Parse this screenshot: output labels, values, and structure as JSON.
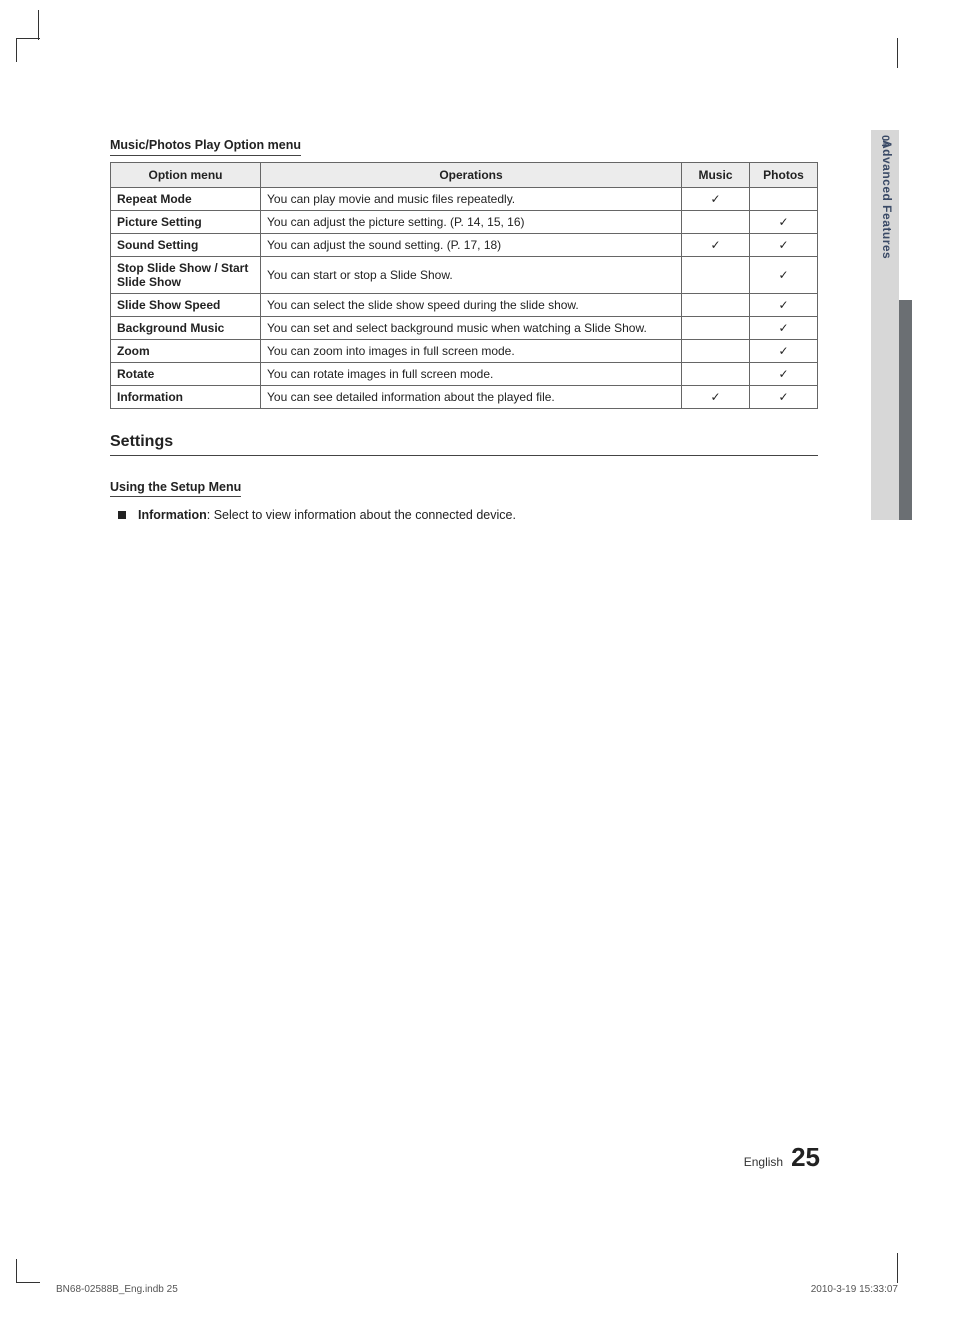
{
  "side_tab": {
    "number": "04",
    "label": "Advanced Features"
  },
  "section_title": "Music/Photos Play Option menu",
  "table": {
    "headers": {
      "option": "Option menu",
      "operations": "Operations",
      "music": "Music",
      "photos": "Photos"
    },
    "check": "✓",
    "rows": [
      {
        "name": "Repeat Mode",
        "op": "You can play movie and music files repeatedly.",
        "music": true,
        "photos": false
      },
      {
        "name": "Picture Setting",
        "op": "You can adjust the picture setting. (P. 14, 15, 16)",
        "music": false,
        "photos": true
      },
      {
        "name": "Sound Setting",
        "op": "You can adjust the sound setting. (P. 17, 18)",
        "music": true,
        "photos": true
      },
      {
        "name": "Stop Slide Show / Start Slide Show",
        "op": "You can start or stop a Slide Show.",
        "music": false,
        "photos": true
      },
      {
        "name": "Slide Show Speed",
        "op": "You can select the slide show speed during the slide show.",
        "music": false,
        "photos": true
      },
      {
        "name": "Background Music",
        "op": "You can set and select background music when watching a Slide Show.",
        "music": false,
        "photos": true
      },
      {
        "name": "Zoom",
        "op": "You can zoom into images in full screen mode.",
        "music": false,
        "photos": true
      },
      {
        "name": "Rotate",
        "op": "You can rotate images in full screen mode.",
        "music": false,
        "photos": true
      },
      {
        "name": "Information",
        "op": "You can see detailed information about the played file.",
        "music": true,
        "photos": true
      }
    ]
  },
  "settings_heading": "Settings",
  "sub_heading": "Using the Setup Menu",
  "bullet": {
    "bold": "Information",
    "rest": ": Select to view information about the connected device."
  },
  "page": {
    "lang": "English",
    "num": "25"
  },
  "footer": {
    "left": "BN68-02588B_Eng.indb   25",
    "right": "2010-3-19   15:33:07"
  }
}
